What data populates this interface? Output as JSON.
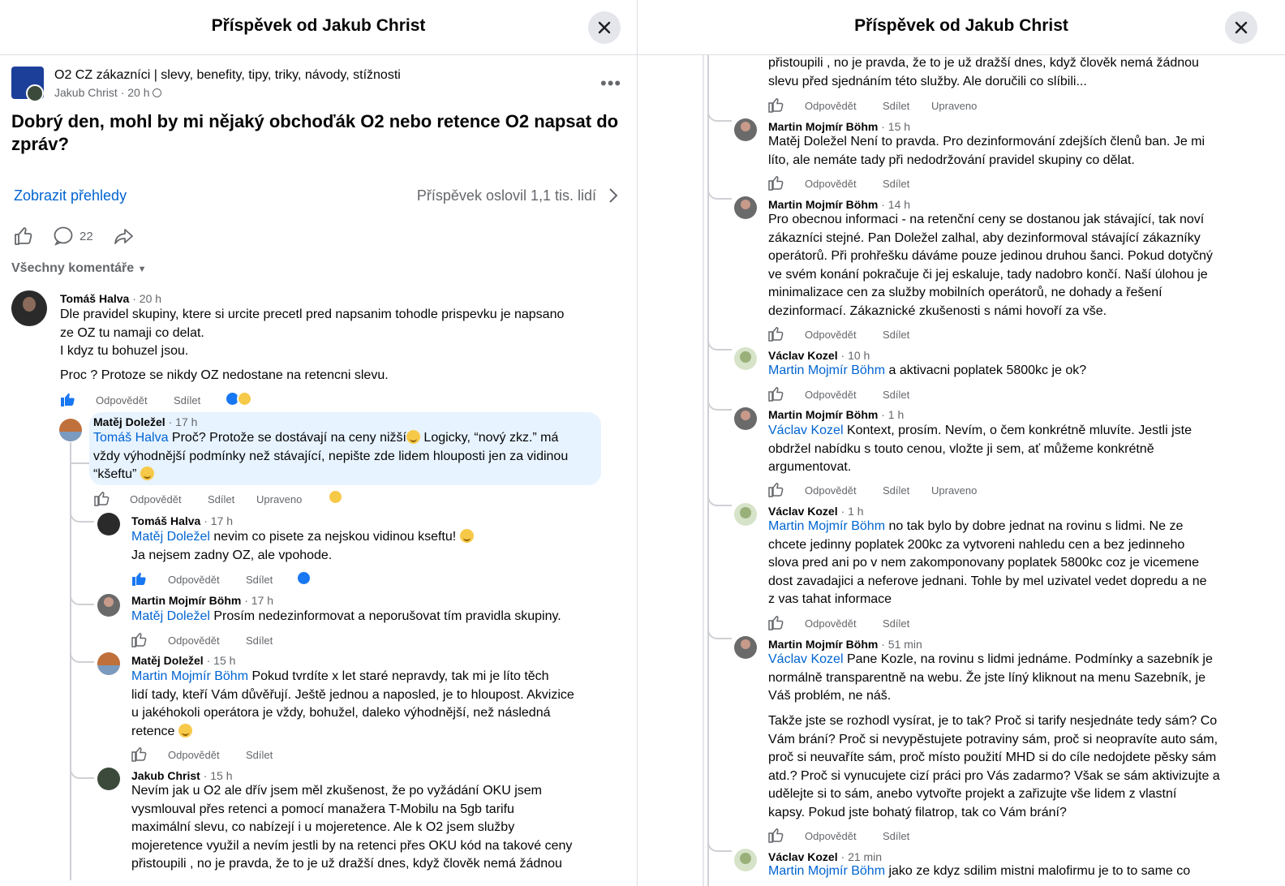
{
  "left": {
    "title": "Příspěvek od Jakub Christ",
    "group_name": "O2 CZ zákazníci | slevy, benefity, tipy, triky, návody, stížnosti",
    "author": "Jakub Christ",
    "time": "20 h",
    "post_text": "Dobrý den, mohl by mi nějaký obchoďák O2 nebo retence O2 napsat do zpráv?",
    "insights_label": "Zobrazit přehledy",
    "reach": "Příspěvek oslovil 1,1 tis. lidí",
    "comment_count": "22",
    "all_comments": "Všechny komentáře",
    "comments": [
      {
        "name": "Tomáš Halva",
        "time": "20 h",
        "lines": [
          "Dle pravidel skupiny, ktere si urcite precetl pred napsanim tohodle prispevku je napsano",
          "ze OZ tu namaji co delat.",
          "I kdyz tu bohuzel jsou."
        ],
        "line2": "Proc ? Protoze se nikdy OZ nedostane na retencni slevu."
      },
      {
        "name": "Matěj Doležel",
        "time": "17 h",
        "tag": "Tomáš Halva",
        "l1": " Proč? Protože se dostávají na ceny nižší",
        "l1b": " Logicky, “nový zkz.” má",
        "l2": "vždy výhodnější podmínky než stávající, nepište zde lidem hlouposti jen za vidinou",
        "l3": "“kšeftu” ",
        "edited": "Upraveno"
      },
      {
        "name": "Tomáš Halva",
        "time": "17 h",
        "tag": "Matěj Doležel",
        "l1": " nevim co pisete za nejskou vidinou kseftu! ",
        "l2": "Ja nejsem zadny OZ, ale vpohode."
      },
      {
        "name": "Martin Mojmír Böhm",
        "time": "17 h",
        "tag": "Matěj Doležel",
        "l1": " Prosím nedezinformovat a neporušovat tím pravidla skupiny."
      },
      {
        "name": "Matěj Doležel",
        "time": "15 h",
        "tag": "Martin Mojmír Böhm",
        "l1": " Pokud tvrdíte x let staré nepravdy, tak mi je líto těch",
        "l2": "lidí tady, kteří Vám důvěřují. Ještě jednou a naposled, je to hloupost. Akvizice",
        "l3": "u jakéhokoli operátora je vždy, bohužel, daleko výhodnější, než následná",
        "l4": "retence "
      },
      {
        "name": "Jakub Christ",
        "time": "15 h",
        "lines": [
          "Nevím jak u O2 ale dřív jsem měl zkušenost, že po vyžádání OKU jsem",
          "vysmlouval přes retenci a pomocí manažera T-Mobilu na 5gb tarifu",
          "maximální slevu, co nabízejí i u mojeretence. Ale k O2 jsem služby",
          "mojeretence využil a nevím jestli by na retenci přes OKU kód na takové ceny",
          "přistoupili , no je pravda, že to je už dražší dnes, když člověk nemá žádnou"
        ]
      }
    ]
  },
  "right": {
    "title": "Příspěvek od Jakub Christ",
    "top_lines": [
      "přistoupili , no je pravda, že to je už dražší dnes, když člověk nemá žádnou",
      "slevu před sjednáním této služby. Ale doručili co slíbili..."
    ],
    "edited": "Upraveno",
    "comments": [
      {
        "name": "Martin Mojmír Böhm",
        "time": "15 h",
        "lines": [
          "Matěj Doležel Není to pravda. Pro dezinformování zdejších členů ban. Je mi",
          "líto, ale nemáte tady při nedodržování pravidel skupiny co dělat."
        ]
      },
      {
        "name": "Martin Mojmír Böhm",
        "time": "14 h",
        "lines": [
          "Pro obecnou informaci - na retenční ceny se dostanou jak stávající, tak noví",
          "zákazníci stejné. Pan Doležel zalhal, aby dezinformoval stávající zákazníky",
          "operátorů. Při prohřešku dáváme pouze jedinou druhou šanci. Pokud dotyčný",
          "ve svém konání pokračuje či jej eskaluje, tady nadobro končí. Naší úlohou je",
          "minimalizace cen za služby mobilních operátorů, ne dohady a řešení",
          "dezinformací. Zákaznické zkušenosti s námi hovoří za vše."
        ]
      },
      {
        "name": "Václav Kozel",
        "time": "10 h",
        "tag": "Martin Mojmír Böhm",
        "l1": " a aktivacni poplatek 5800kc je ok?"
      },
      {
        "name": "Martin Mojmír Böhm",
        "time": "1 h",
        "tag": "Václav Kozel",
        "l1": " Kontext, prosím. Nevím, o čem konkrétně mluvíte. Jestli jste",
        "lines": [
          "obdržel nabídku s touto cenou, vložte ji sem, ať můžeme konkrétně",
          "argumentovat."
        ]
      },
      {
        "name": "Václav Kozel",
        "time": "1 h",
        "tag": "Martin Mojmír Böhm",
        "l1": " no tak bylo by dobre jednat na rovinu s lidmi. Ne ze",
        "lines": [
          "chcete jedinny poplatek 200kc za vytvoreni nahledu cen a bez jedinneho",
          "slova pred ani po v nem zakomponovany poplatek 5800kc coz je vicemene",
          "dost zavadajici a neferove jednani. Tohle by mel uzivatel vedet dopredu a ne",
          "z vas tahat informace"
        ]
      },
      {
        "name": "Martin Mojmír Böhm",
        "time": "51 min",
        "tag": "Václav Kozel",
        "l1": " Pane Kozle, na rovinu s lidmi jednáme. Podmínky a sazebník je",
        "lines": [
          "normálně transparentně na webu. Že jste líný kliknout na menu Sazebník, je",
          "Váš problém, ne náš."
        ],
        "lines2": [
          "Takže jste se rozhodl vysírat, je to tak? Proč si tarify nesjednáte tedy sám? Co",
          "Vám brání? Proč si nevypěstujete potraviny sám, proč si neopravíte auto sám,",
          "proč si neuvaříte sám, proč místo použití MHD si do cíle nedojdete pěsky sám",
          "atd.? Proč si vynucujete cizí práci pro Vás zadarmo? Však se sám aktivizujte a",
          "udělejte si to sám, anebo vytvořte projekt a zařizujte vše lidem z vlastní",
          "kapsy. Pokud jste bohatý filatrop, tak co Vám brání?"
        ]
      },
      {
        "name": "Václav Kozel",
        "time": "21 min",
        "tag": "Martin Mojmír Böhm",
        "l1": " jako ze kdyz sdilim mistni malofirmu je to to same co"
      }
    ]
  },
  "actions": {
    "reply": "Odpovědět",
    "share": "Sdílet"
  }
}
